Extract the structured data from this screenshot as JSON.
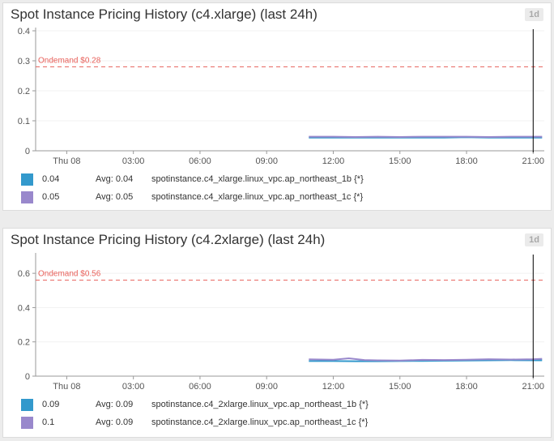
{
  "panels": [
    {
      "title": "Spot Instance Pricing History (c4.xlarge) (last 24h)",
      "range_badge": "1d",
      "legend": [
        {
          "value": "0.04",
          "avg_label": "Avg: 0.04",
          "metric": "spotinstance.c4_xlarge.linux_vpc.ap_northeast_1b {*}",
          "color": "#3399cc"
        },
        {
          "value": "0.05",
          "avg_label": "Avg: 0.05",
          "metric": "spotinstance.c4_xlarge.linux_vpc.ap_northeast_1c {*}",
          "color": "#9988cc"
        }
      ]
    },
    {
      "title": "Spot Instance Pricing History (c4.2xlarge) (last 24h)",
      "range_badge": "1d",
      "legend": [
        {
          "value": "0.09",
          "avg_label": "Avg: 0.09",
          "metric": "spotinstance.c4_2xlarge.linux_vpc.ap_northeast_1b {*}",
          "color": "#3399cc"
        },
        {
          "value": "0.1",
          "avg_label": "Avg: 0.09",
          "metric": "spotinstance.c4_2xlarge.linux_vpc.ap_northeast_1c {*}",
          "color": "#9988cc"
        }
      ]
    }
  ],
  "chart_data": [
    {
      "type": "line",
      "title": "Spot Instance Pricing History (c4.xlarge) (last 24h)",
      "x_unit": "hours from 03:00 Wed 07",
      "x_ticks": [
        {
          "x": 0,
          "label": "Thu 08"
        },
        {
          "x": 3,
          "label": "03:00"
        },
        {
          "x": 6,
          "label": "06:00"
        },
        {
          "x": 9,
          "label": "09:00"
        },
        {
          "x": 12,
          "label": "12:00"
        },
        {
          "x": 15,
          "label": "15:00"
        },
        {
          "x": 18,
          "label": "18:00"
        },
        {
          "x": 21,
          "label": "21:00"
        }
      ],
      "xlim": [
        -1.4,
        21.5
      ],
      "ylim": [
        0,
        0.4
      ],
      "y_ticks": [
        "0",
        "0.1",
        "0.2",
        "0.3",
        "0.4"
      ],
      "marker_line": {
        "value": 0.28,
        "label": "Ondemand $0.28",
        "color": "#e8605a"
      },
      "vertical_marker_x": 21.0,
      "series": [
        {
          "name": "spotinstance.c4_xlarge.linux_vpc.ap_northeast_1b {*}",
          "color": "#3399cc",
          "x": [
            10.9,
            12,
            13,
            14,
            15,
            16,
            17,
            18,
            19,
            20,
            21.4
          ],
          "y": [
            0.044,
            0.044,
            0.044,
            0.044,
            0.044,
            0.044,
            0.044,
            0.045,
            0.044,
            0.044,
            0.044
          ]
        },
        {
          "name": "spotinstance.c4_xlarge.linux_vpc.ap_northeast_1c {*}",
          "color": "#9988cc",
          "x": [
            10.9,
            12,
            13,
            14,
            15,
            16,
            17,
            18,
            19,
            20,
            21.4
          ],
          "y": [
            0.047,
            0.047,
            0.046,
            0.047,
            0.046,
            0.047,
            0.047,
            0.047,
            0.046,
            0.047,
            0.047
          ]
        }
      ]
    },
    {
      "type": "line",
      "title": "Spot Instance Pricing History (c4.2xlarge) (last 24h)",
      "x_unit": "hours from 03:00 Wed 07",
      "x_ticks": [
        {
          "x": 0,
          "label": "Thu 08"
        },
        {
          "x": 3,
          "label": "03:00"
        },
        {
          "x": 6,
          "label": "06:00"
        },
        {
          "x": 9,
          "label": "09:00"
        },
        {
          "x": 12,
          "label": "12:00"
        },
        {
          "x": 15,
          "label": "15:00"
        },
        {
          "x": 18,
          "label": "18:00"
        },
        {
          "x": 21,
          "label": "21:00"
        }
      ],
      "xlim": [
        -1.4,
        21.5
      ],
      "ylim": [
        0,
        0.7
      ],
      "y_ticks": [
        "0",
        "0.2",
        "0.4",
        "0.6"
      ],
      "marker_line": {
        "value": 0.56,
        "label": "Ondemand $0.56",
        "color": "#e8605a"
      },
      "vertical_marker_x": 21.0,
      "series": [
        {
          "name": "spotinstance.c4_2xlarge.linux_vpc.ap_northeast_1b {*}",
          "color": "#3399cc",
          "x": [
            10.9,
            12,
            13,
            14,
            15,
            16,
            17,
            18,
            19,
            20,
            21.4
          ],
          "y": [
            0.088,
            0.088,
            0.087,
            0.087,
            0.088,
            0.089,
            0.09,
            0.091,
            0.092,
            0.093,
            0.092
          ]
        },
        {
          "name": "spotinstance.c4_2xlarge.linux_vpc.ap_northeast_1c {*}",
          "color": "#9988cc",
          "x": [
            10.9,
            12,
            12.7,
            13.4,
            14,
            15,
            16,
            17,
            18,
            19,
            20,
            21,
            21.4
          ],
          "y": [
            0.098,
            0.096,
            0.104,
            0.094,
            0.092,
            0.091,
            0.095,
            0.094,
            0.096,
            0.099,
            0.097,
            0.099,
            0.101
          ]
        }
      ]
    }
  ]
}
